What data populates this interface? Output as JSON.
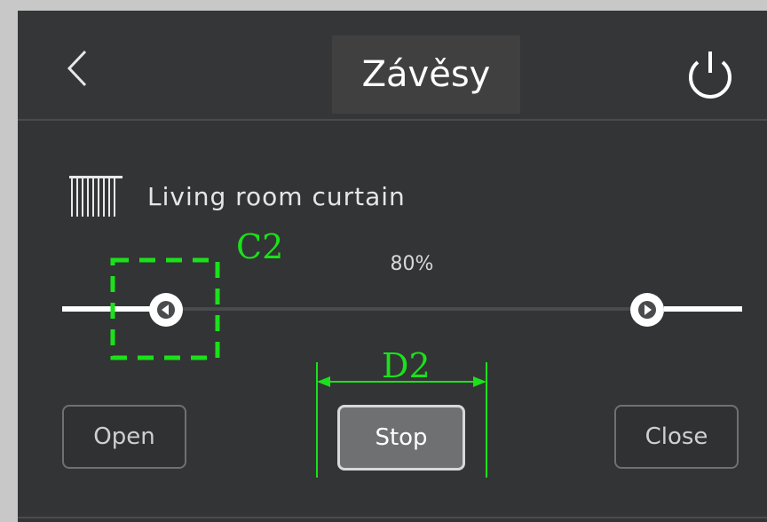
{
  "header": {
    "title": "Závěsy",
    "back_icon": "chevron-left-icon",
    "power_icon": "power-icon"
  },
  "device": {
    "icon": "curtain-icon",
    "label": "Living room curtain"
  },
  "slider": {
    "value_label": "80%",
    "position_percent": 80
  },
  "buttons": {
    "open": "Open",
    "stop": "Stop",
    "close": "Close"
  },
  "annotations": {
    "c2": "C2",
    "d2": "D2",
    "color": "#1be11b"
  }
}
